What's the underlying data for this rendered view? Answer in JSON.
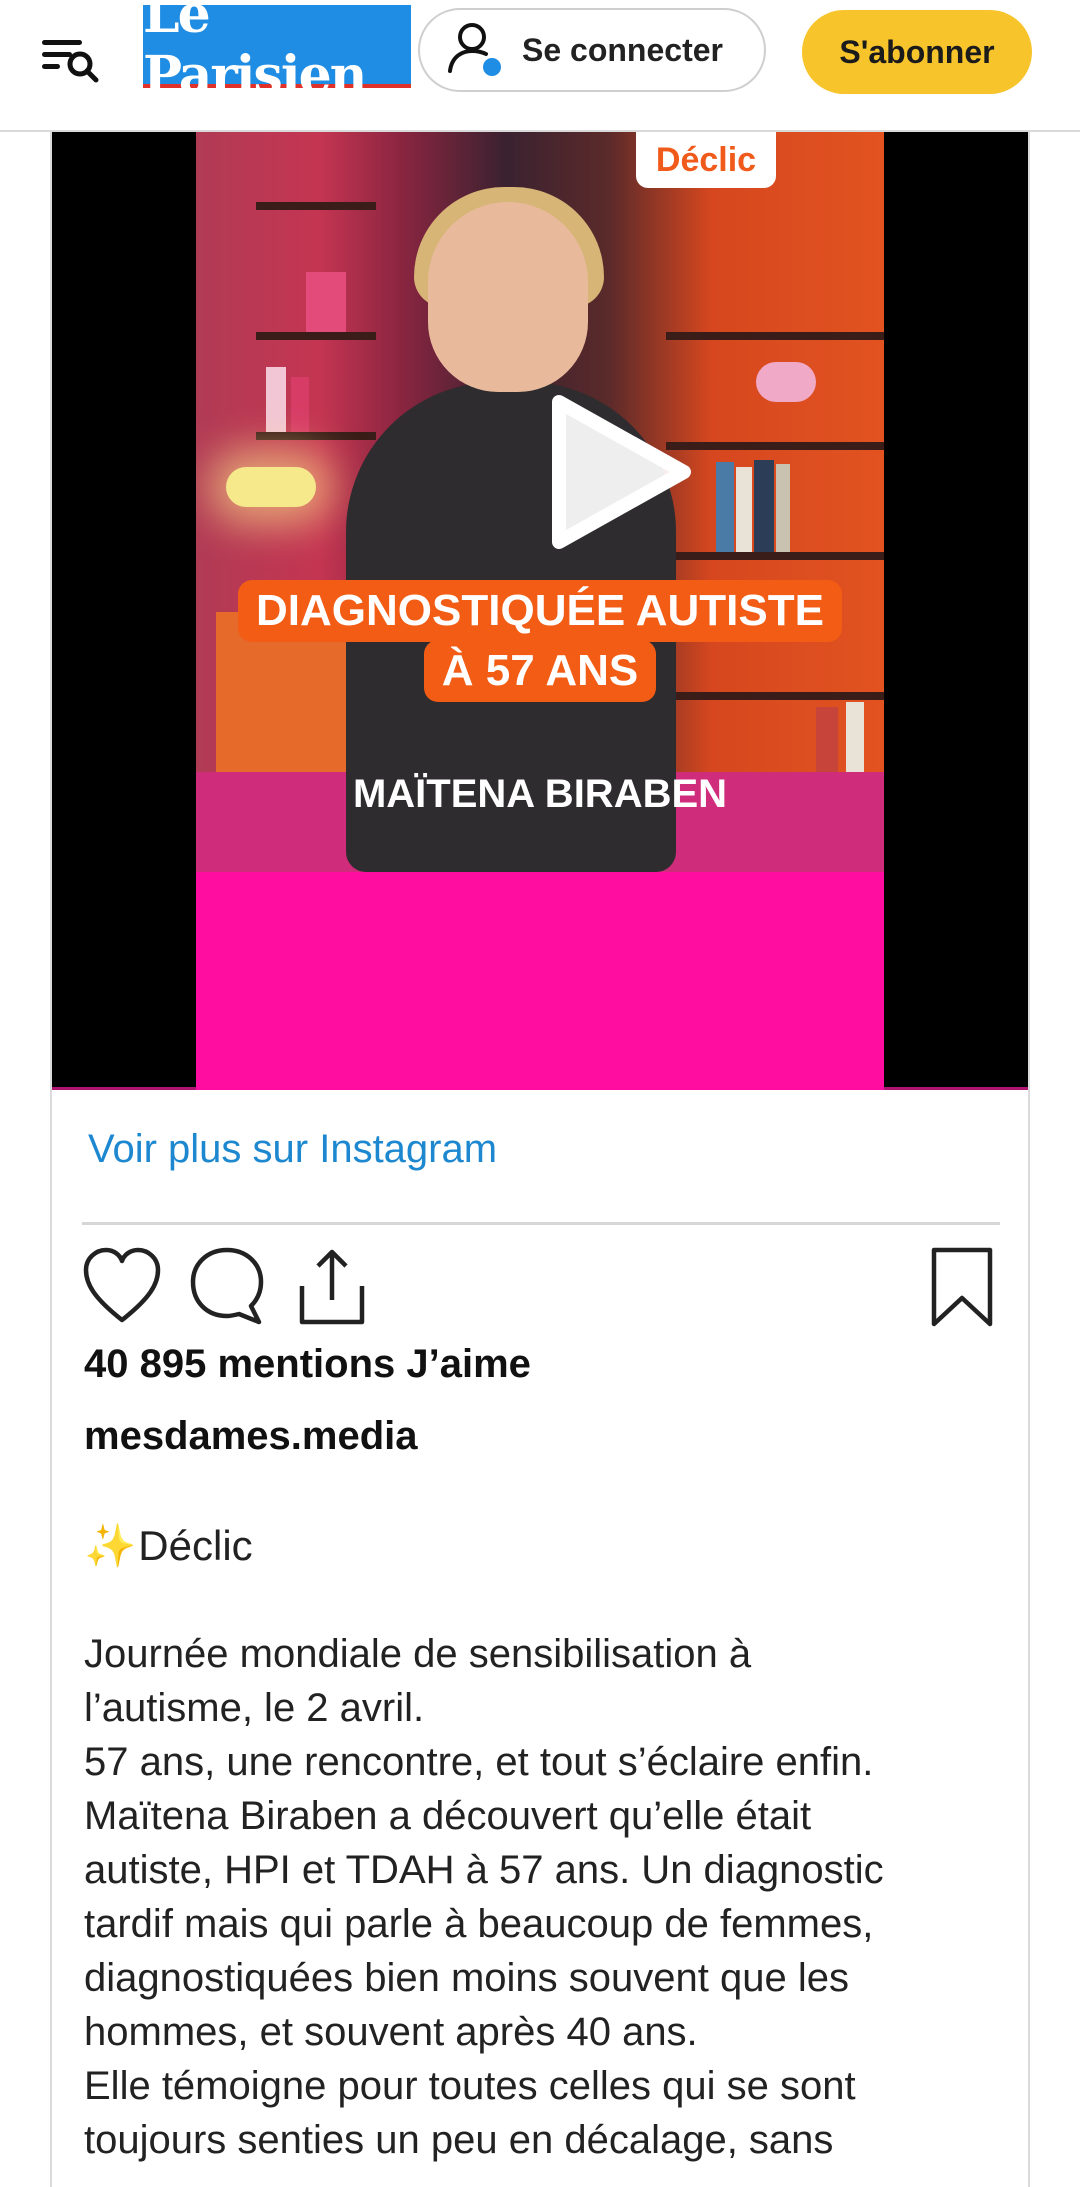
{
  "header": {
    "logo_text": "Le Parisien",
    "login_label": "Se connecter",
    "subscribe_label": "S'abonner",
    "colors": {
      "logo_bg": "#1f8de3",
      "subscribe_bg": "#f7c42b"
    }
  },
  "embed": {
    "media": {
      "brand_tag": "Déclic",
      "headline_line1": "DIAGNOSTIQUÉE AUTISTE",
      "headline_line2": "À 57 ANS",
      "person_name": "MAÏTENA BIRABEN"
    },
    "more_link": "Voir plus sur Instagram",
    "actions": [
      "heart-icon",
      "comment-icon",
      "share-icon",
      "bookmark-icon"
    ],
    "likes": "40 895 mentions J’aime",
    "account": "mesdames.media",
    "caption_tag": "Déclic",
    "caption_lines": [
      "Journée mondiale de sensibilisation à",
      "l’autisme, le 2 avril.",
      "57 ans, une rencontre, et tout s’éclaire enfin.",
      "Maïtena Biraben a découvert qu’elle était",
      "autiste, HPI et TDAH à 57 ans. Un diagnostic",
      "tardif mais qui parle à beaucoup de femmes,",
      "diagnostiquées bien moins souvent que les",
      "hommes, et souvent après 40 ans.",
      "Elle témoigne pour toutes celles qui se sont",
      "toujours senties un peu en décalage, sans"
    ]
  }
}
